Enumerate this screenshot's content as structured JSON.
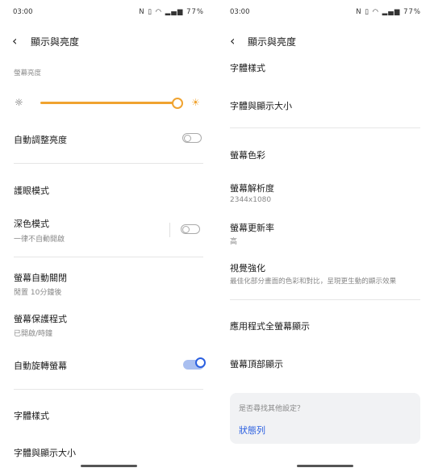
{
  "status_bar": {
    "time": "03:00",
    "battery": "77%"
  },
  "left_screen": {
    "header_title": "顯示與亮度",
    "brightness_label": "螢幕亮度",
    "brightness_level": 1.0,
    "auto_brightness": {
      "label": "自動調整亮度",
      "on": false
    },
    "eye_care": {
      "label": "護眼模式"
    },
    "dark_mode": {
      "label": "深色模式",
      "subtitle": "一律不自動開啟",
      "on": false
    },
    "screen_timeout": {
      "label": "螢幕自動關閉",
      "subtitle": "閒置 10分鐘後"
    },
    "screen_saver": {
      "label": "螢幕保護程式",
      "subtitle": "已開啟/時鐘"
    },
    "auto_rotate": {
      "label": "自動旋轉螢幕",
      "on": true
    },
    "font_style": {
      "label": "字體樣式"
    },
    "font_size": {
      "label": "字體與顯示大小"
    }
  },
  "right_screen": {
    "header_title": "顯示與亮度",
    "font_style": {
      "label": "字體樣式"
    },
    "font_size": {
      "label": "字體與顯示大小"
    },
    "screen_color": {
      "label": "螢幕色彩"
    },
    "resolution": {
      "label": "螢幕解析度",
      "subtitle": "2344x1080"
    },
    "refresh_rate": {
      "label": "螢幕更新率",
      "subtitle": "高"
    },
    "visual_enhance": {
      "label": "視覺強化",
      "subtitle": "最佳化部分畫面的色彩和對比，呈現更生動的顯示效果"
    },
    "fullscreen_apps": {
      "label": "應用程式全螢幕顯示"
    },
    "top_display": {
      "label": "螢幕頂部顯示"
    },
    "suggestion_card": {
      "question": "是否尋找其他設定？",
      "link": "狀態列"
    }
  },
  "colors": {
    "accent_orange": "#f0a330",
    "accent_blue": "#2a5fe0"
  }
}
